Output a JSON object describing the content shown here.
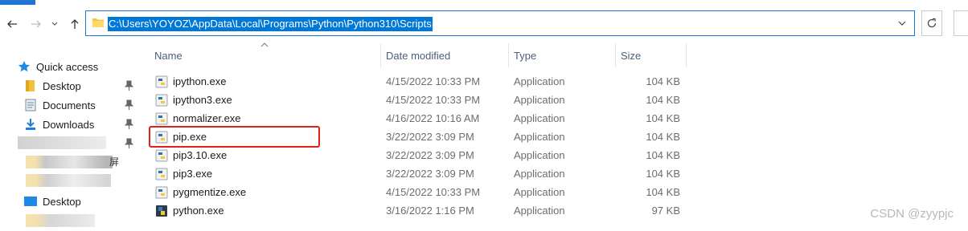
{
  "address": {
    "path": "C:\\Users\\YOYOZ\\AppData\\Local\\Programs\\Python\\Python310\\Scripts"
  },
  "nav_pane": {
    "quick_access": "Quick access",
    "items": [
      {
        "label": "Desktop",
        "icon": "folder-desktop-icon",
        "pinned": true
      },
      {
        "label": "Documents",
        "icon": "documents-icon",
        "pinned": true
      },
      {
        "label": "Downloads",
        "icon": "downloads-icon",
        "pinned": true
      }
    ],
    "partial_label": "屏",
    "desktop_label": "Desktop"
  },
  "columns": {
    "name": "Name",
    "date": "Date modified",
    "type": "Type",
    "size": "Size"
  },
  "files": [
    {
      "name": "ipython.exe",
      "date": "4/15/2022 10:33 PM",
      "type": "Application",
      "size": "104 KB"
    },
    {
      "name": "ipython3.exe",
      "date": "4/15/2022 10:33 PM",
      "type": "Application",
      "size": "104 KB"
    },
    {
      "name": "normalizer.exe",
      "date": "4/16/2022 10:16 AM",
      "type": "Application",
      "size": "104 KB"
    },
    {
      "name": "pip.exe",
      "date": "3/22/2022 3:09 PM",
      "type": "Application",
      "size": "104 KB"
    },
    {
      "name": "pip3.10.exe",
      "date": "3/22/2022 3:09 PM",
      "type": "Application",
      "size": "104 KB"
    },
    {
      "name": "pip3.exe",
      "date": "3/22/2022 3:09 PM",
      "type": "Application",
      "size": "104 KB"
    },
    {
      "name": "pygmentize.exe",
      "date": "4/15/2022 10:33 PM",
      "type": "Application",
      "size": "104 KB"
    },
    {
      "name": "python.exe",
      "date": "3/16/2022 1:16 PM",
      "type": "Application",
      "size": "97 KB"
    }
  ],
  "colors": {
    "accent": "#0078d7",
    "highlight": "#e0201b"
  },
  "watermark": "CSDN @zyypjc"
}
